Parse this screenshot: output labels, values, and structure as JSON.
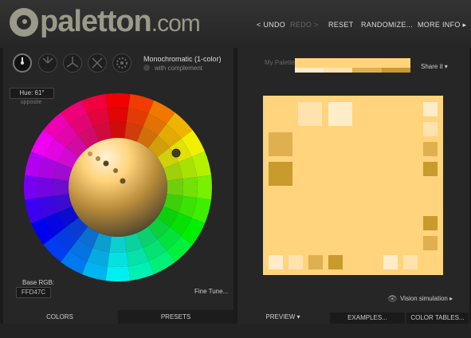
{
  "header": {
    "logo_text": "paletton",
    "logo_suffix": ".com",
    "menu": {
      "undo": "< UNDO",
      "redo": "REDO >",
      "reset": "RESET",
      "randomize": "RANDOMIZE...",
      "more_info": "MORE INFO ▸"
    }
  },
  "left": {
    "scheme_icons": [
      "mono-icon",
      "adjacent-icon",
      "triad-icon",
      "tetrad-icon",
      "free-style-icon"
    ],
    "scheme_title": "Monochromatic (1-color)",
    "complement_label": "with complement",
    "hue_label": "Hue: 61°",
    "opposite_label": "opposite",
    "base_rgb_label": "Base RGB:",
    "base_rgb_value": "FFD47C",
    "fine_tune": "Fine Tune...",
    "tabs": {
      "colors": "COLORS",
      "presets": "PRESETS"
    }
  },
  "right": {
    "my_palette_label": "My Palette",
    "share_it": "Share it ▾",
    "vision_label": "Vision simulation ▸",
    "tabs": {
      "preview": "PREVIEW ▾",
      "examples": "EXAMPLES...",
      "color_tables": "COLOR TABLES..."
    }
  },
  "colors": {
    "base": "#FFD47C",
    "light1": "#FFE3AE",
    "light2": "#FFEDC9",
    "dark1": "#E0B050",
    "dark2": "#C99A2C",
    "strip": [
      "#FFD47C",
      "#FFEDC9",
      "#FFE3AE",
      "#E0B050",
      "#C99A2C"
    ]
  }
}
